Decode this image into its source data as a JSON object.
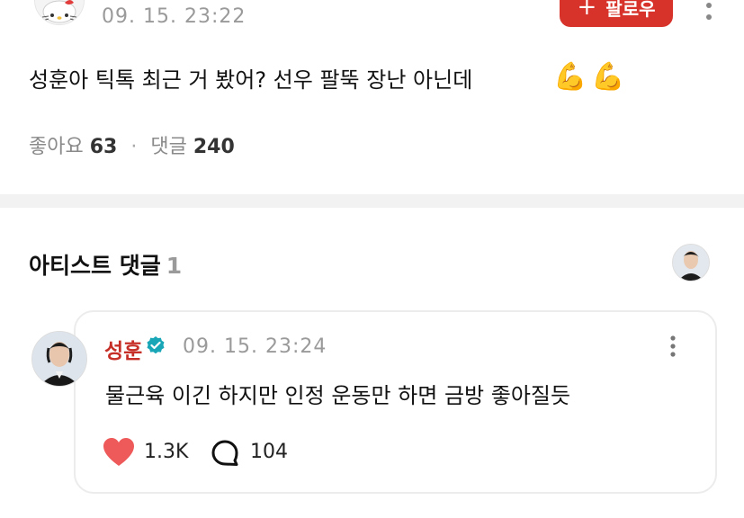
{
  "post": {
    "timestamp": "09. 15. 23:22",
    "follow_label": "팔로우",
    "text": "성훈아 틱톡 최근 거 봤어? 선우 팔뚝 장난 아닌데",
    "emoji": "💪",
    "likes_label": "좋아요",
    "likes_count": "63",
    "comments_label": "댓글",
    "comments_count": "240"
  },
  "artist_comments": {
    "title": "아티스트 댓글",
    "count": "1"
  },
  "comment": {
    "author": "성훈",
    "timestamp": "09. 15. 23:24",
    "text": "물근육 이긴 하지만 인정 운동만 하면 금방 좋아질듯",
    "likes": "1.3K",
    "replies": "104"
  },
  "colors": {
    "accent_red": "#d7332b",
    "author_red": "#c62f27",
    "verified_teal": "#19a7b8",
    "heart": "#ee5a5a"
  }
}
